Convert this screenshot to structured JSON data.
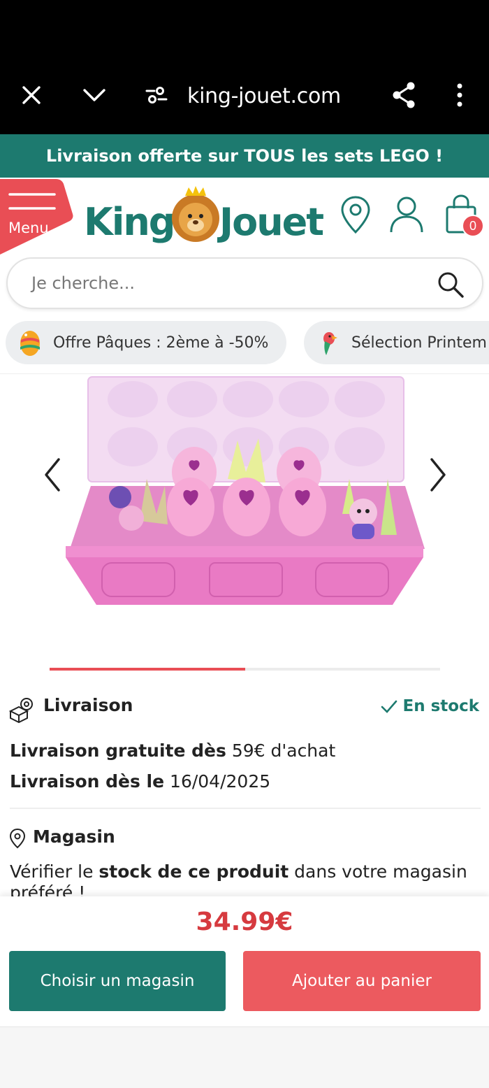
{
  "browser": {
    "url": "king-jouet.com",
    "icons": [
      "close-icon",
      "chevron-down-icon",
      "site-settings-icon",
      "share-icon",
      "more-vert-icon"
    ]
  },
  "promo": {
    "text": "Livraison offerte sur TOUS les sets LEGO !"
  },
  "header": {
    "menu_label": "Menu",
    "logo_text": "King Jouet",
    "cart_count": "0"
  },
  "search": {
    "placeholder": "Je cherche..."
  },
  "chips": [
    {
      "label": "Offre Pâques : 2ème à -50%",
      "icon": "easter-egg-icon"
    },
    {
      "label": "Sélection Printem",
      "icon": "parrot-icon"
    }
  ],
  "gallery": {
    "progress": 0.5
  },
  "delivery": {
    "title": "Livraison",
    "stock_status": "En stock",
    "line1_bold": "Livraison gratuite dès",
    "line1_rest": " 59€ d'achat",
    "line2_bold": "Livraison dès le",
    "line2_rest": " 16/04/2025"
  },
  "store": {
    "title": "Magasin",
    "text_a": "Vérifier le ",
    "text_bold": "stock de ce produit",
    "text_b": " dans votre magasin",
    "text_c": "préféré !"
  },
  "purchase": {
    "price": "34.99€",
    "choose_store_label": "Choisir un magasin",
    "add_to_cart_label": "Ajouter au panier"
  },
  "colors": {
    "brand_teal": "#1d7a6f",
    "accent_red": "#e94e55",
    "price_red": "#d63a3f"
  }
}
